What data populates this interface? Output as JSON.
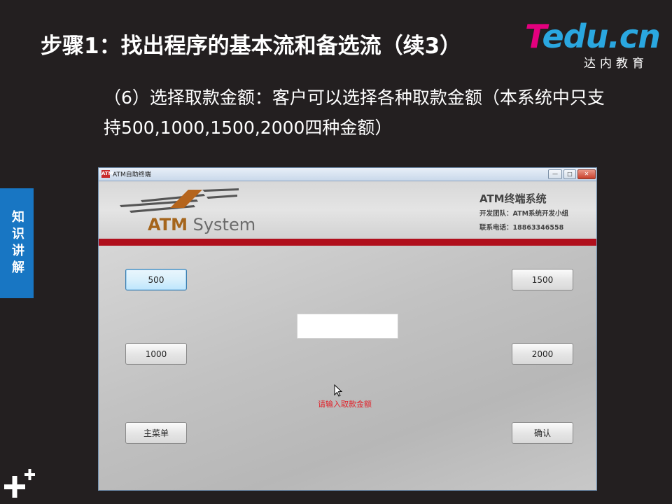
{
  "slide": {
    "title": "步骤1：找出程序的基本流和备选流（续3）",
    "body": "（6）选择取款金额：客户可以选择各种取款金额（本系统中只支持500,1000,1500,2000四种金额）",
    "side_tab": "知识讲解"
  },
  "logo": {
    "mark_t": "T",
    "mark_rest": "edu.cn",
    "subtitle": "达内教育"
  },
  "window": {
    "title": "ATM自助终端",
    "icon_text": "ATM",
    "buttons": {
      "minimize": "—",
      "maximize": "□",
      "close": "✕"
    }
  },
  "atm_header": {
    "logo_atm": "ATM",
    "logo_system": "System",
    "title": "ATM终端系统",
    "team": "开发团队：ATM系统开发小组",
    "phone": "联系电话：18863346558"
  },
  "buttons": {
    "b500": "500",
    "b1000": "1000",
    "b1500": "1500",
    "b2000": "2000",
    "main_menu": "主菜单",
    "confirm": "确认"
  },
  "amount_input": {
    "value": ""
  },
  "hint": "请输入取款金额",
  "colors": {
    "background": "#231f20",
    "side_tab": "#1876c3",
    "red_bar": "#b00f1c",
    "hint": "#e0222a"
  }
}
